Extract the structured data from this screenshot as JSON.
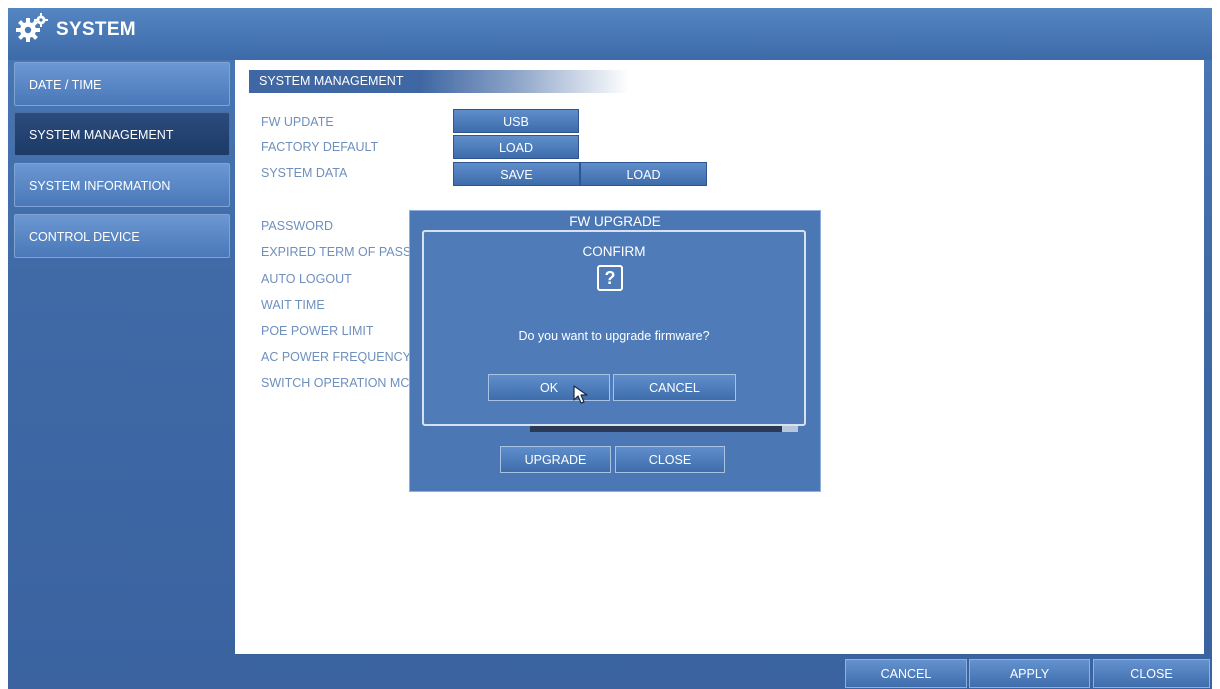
{
  "header": {
    "title": "SYSTEM",
    "icon": "gears-icon"
  },
  "sidebar": {
    "items": [
      {
        "label": "DATE / TIME",
        "active": false
      },
      {
        "label": "SYSTEM MANAGEMENT",
        "active": true
      },
      {
        "label": "SYSTEM INFORMATION",
        "active": false
      },
      {
        "label": "CONTROL DEVICE",
        "active": false
      }
    ]
  },
  "main": {
    "section_title": "SYSTEM MANAGEMENT",
    "fw_update": {
      "label": "FW UPDATE",
      "button": "USB"
    },
    "factory_default": {
      "label": "FACTORY DEFAULT",
      "button": "LOAD"
    },
    "system_data": {
      "label": "SYSTEM DATA",
      "save_button": "SAVE",
      "load_button": "LOAD"
    },
    "settings": [
      "PASSWORD",
      "EXPIRED TERM OF PASS",
      "AUTO LOGOUT",
      "WAIT TIME",
      "POE POWER LIMIT",
      "AC POWER FREQUENCY",
      "SWITCH OPERATION MC"
    ]
  },
  "fw_dialog": {
    "title": "FW UPGRADE",
    "upgrade_button": "UPGRADE",
    "close_button": "CLOSE"
  },
  "confirm_dialog": {
    "title": "CONFIRM",
    "icon": "question-icon",
    "icon_glyph": "?",
    "message": "Do you want to upgrade firmware?",
    "ok_button": "OK",
    "cancel_button": "CANCEL"
  },
  "footer": {
    "cancel": "CANCEL",
    "apply": "APPLY",
    "close": "CLOSE"
  },
  "colors": {
    "frame": "#3f6aa6",
    "active_tab": "#1d3a66",
    "label_text": "#6f8fbd"
  }
}
